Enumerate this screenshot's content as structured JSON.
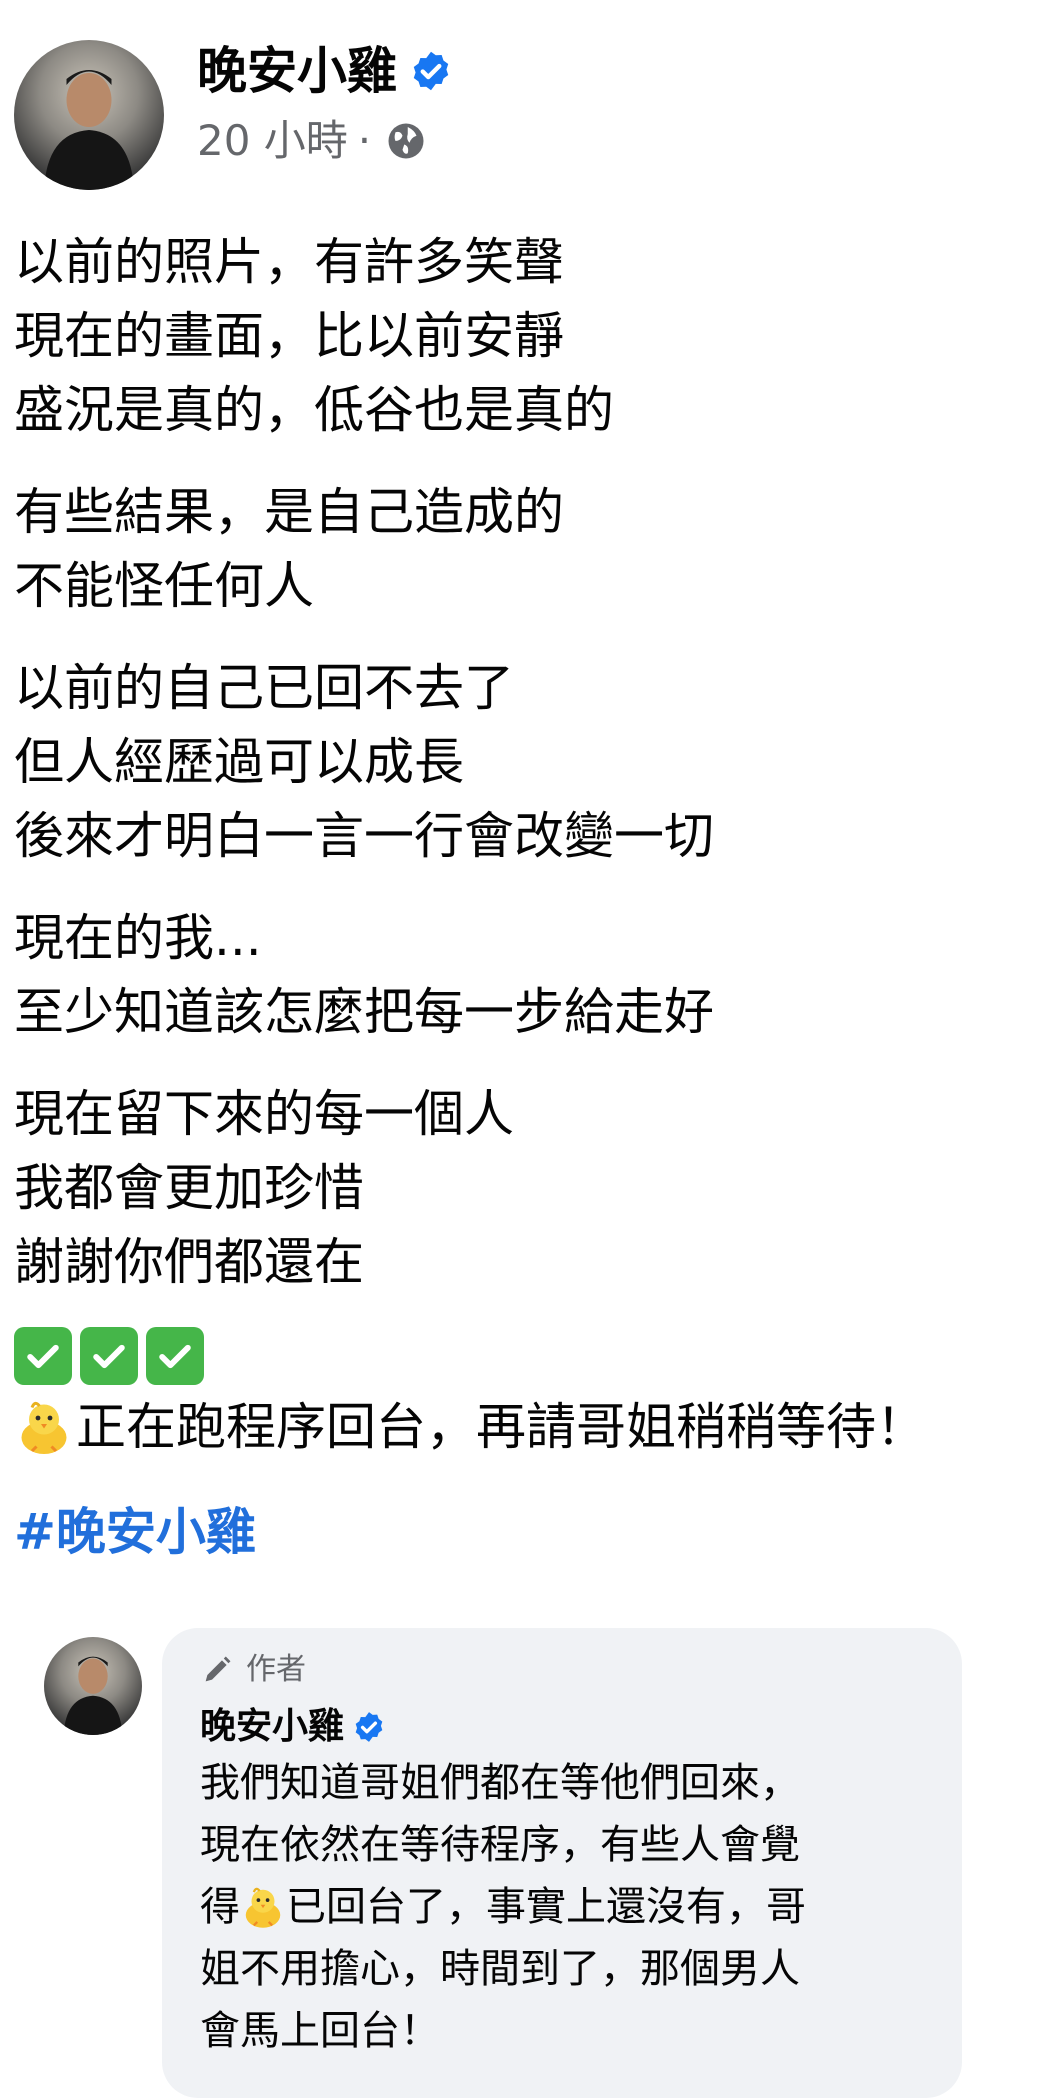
{
  "post": {
    "author": "晚安小雞",
    "time": "20 小時",
    "separator": "·",
    "paragraphs": [
      [
        "以前的照片，有許多笑聲",
        "現在的畫面，比以前安靜",
        "盛況是真的，低谷也是真的"
      ],
      [
        "有些結果，是自己造成的",
        "不能怪任何人"
      ],
      [
        "以前的自己已回不去了",
        "但人經歷過可以成長",
        "後來才明白一言一行會改變一切"
      ],
      [
        "現在的我...",
        "至少知道該怎麼把每一步給走好"
      ],
      [
        "現在留下來的每一個人",
        "我都會更加珍惜",
        "謝謝你們都還在"
      ]
    ],
    "emoji_line_text": "正在跑程序回台，再請哥姐稍稍等待！",
    "hashtag": "#晚安小雞"
  },
  "comment": {
    "badge": "作者",
    "author": "晚安小雞",
    "lines": {
      "l1": "我們知道哥姐們都在等他們回來，",
      "l2": "現在依然在等待程序，有些人會覺",
      "l3a": "得",
      "l3b": "已回台了，事實上還沒有，哥",
      "l4": "姐不用擔心，時間到了，那個男人",
      "l5": "會馬上回台！"
    }
  },
  "colors": {
    "link": "#216fdb",
    "verified": "#1877f2",
    "meta": "#65676b",
    "bubble": "#f0f2f5"
  },
  "icons": [
    "verified-badge-icon",
    "globe-icon",
    "check-mark-emoji",
    "chick-emoji",
    "pencil-icon"
  ]
}
